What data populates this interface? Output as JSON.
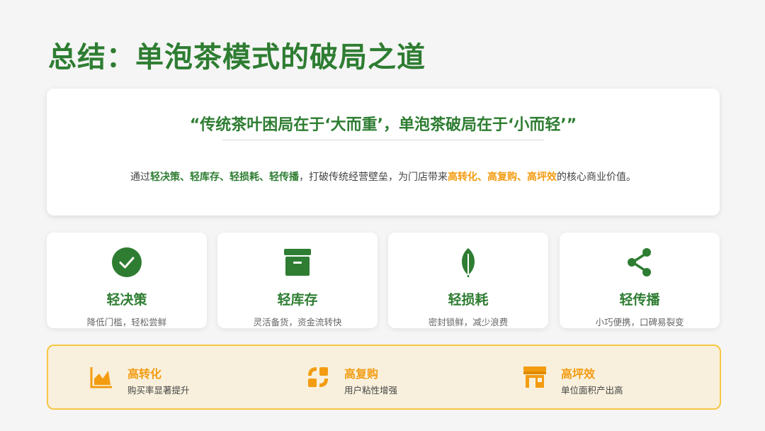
{
  "title": "总结：单泡茶模式的破局之道",
  "quote": "“传统茶叶困局在于‘大而重’，单泡茶破局在于‘小而轻’”",
  "summary": {
    "prefix": "通过",
    "lights": "轻决策、轻库存、轻损耗、轻传播",
    "middle": "，打破传统经营壁垒，为门店带来",
    "highs": "高转化、高复购、高坪效",
    "suffix": "的核心商业价值。"
  },
  "features": [
    {
      "icon": "check-circle-icon",
      "title": "轻决策",
      "desc": "降低门槛，轻松尝鲜"
    },
    {
      "icon": "box-icon",
      "title": "轻库存",
      "desc": "灵活备货，资金流转快"
    },
    {
      "icon": "leaf-icon",
      "title": "轻损耗",
      "desc": "密封锁鲜，减少浪费"
    },
    {
      "icon": "share-icon",
      "title": "轻传播",
      "desc": "小巧便携，口碑易裂变"
    }
  ],
  "benefits": [
    {
      "icon": "area-chart-icon",
      "title": "高转化",
      "desc": "购买率显著提升"
    },
    {
      "icon": "repeat-icon",
      "title": "高复购",
      "desc": "用户粘性增强"
    },
    {
      "icon": "store-icon",
      "title": "高坪效",
      "desc": "单位面积产出高"
    }
  ],
  "colors": {
    "green": "#2e7d32",
    "orange": "#f39c12",
    "border": "#f6c644",
    "panel": "#f8f0dc"
  }
}
